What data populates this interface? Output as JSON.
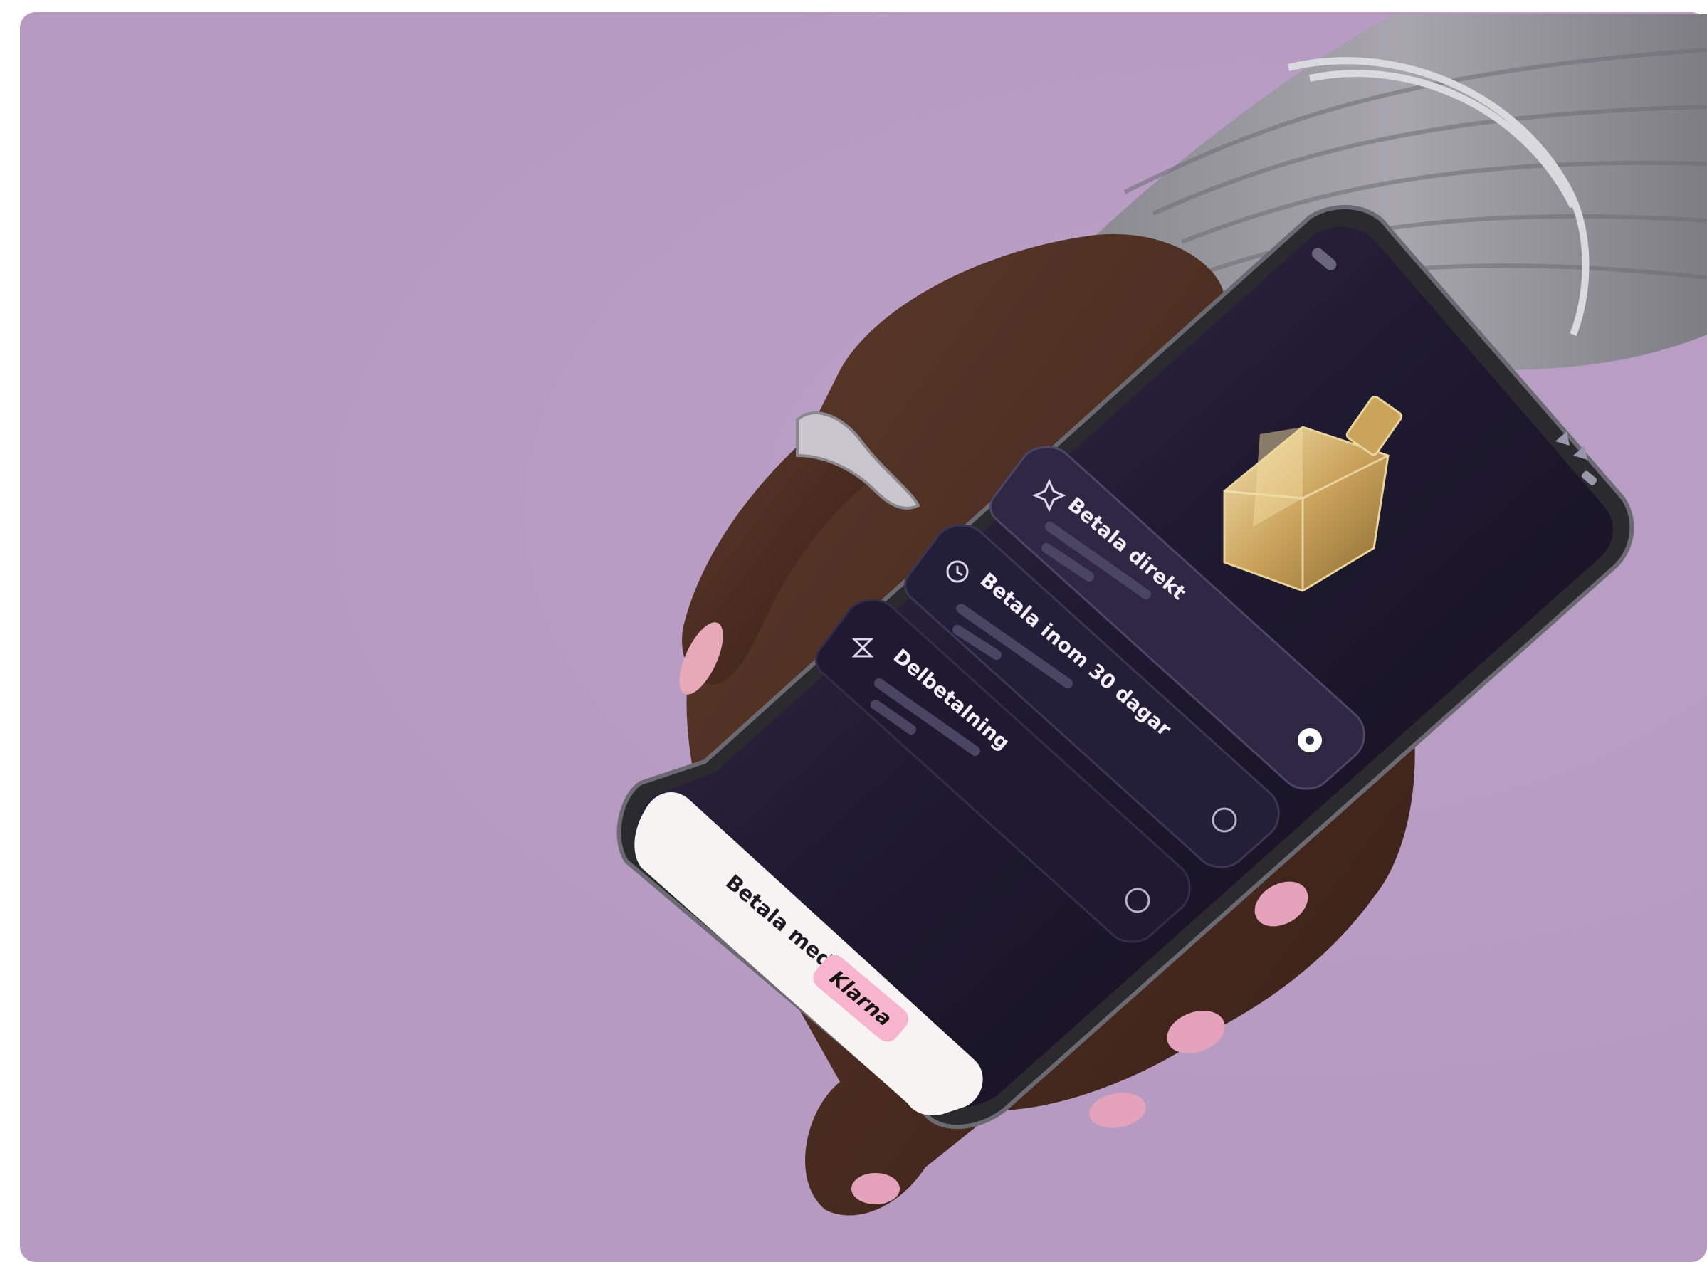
{
  "scene": {
    "description_alt": "",
    "background_color": "#b69ac2"
  },
  "options": [
    {
      "label": "Betala direkt",
      "icon": "sparkle-icon",
      "selected": true
    },
    {
      "label": "Betala inom 30 dagar",
      "icon": "clock-icon",
      "selected": false
    },
    {
      "label": "Delbetalning",
      "icon": "hourglass-icon",
      "selected": false
    }
  ],
  "cta": {
    "prefix": "Betala med",
    "brand": "Klarna"
  },
  "colors": {
    "screen": "#1a1528",
    "option_card": "#2a2440",
    "brand_pink": "#f7b4cf",
    "cta_background": "#f7f3f3"
  }
}
